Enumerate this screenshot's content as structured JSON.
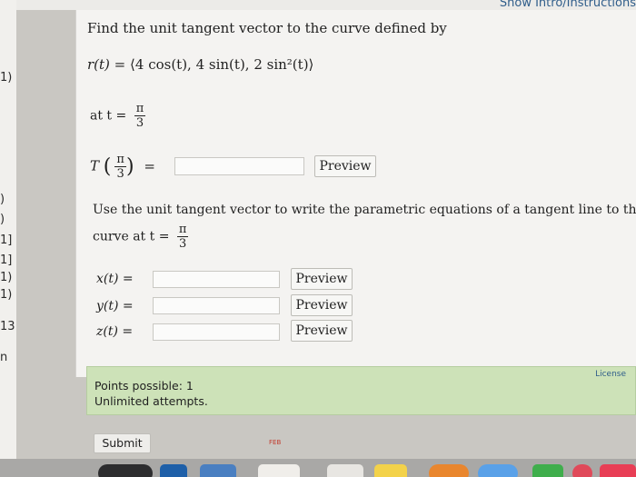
{
  "header": {
    "show_intro_link": "Show Intro/Instructions"
  },
  "left_column_fragments": [
    "1)",
    ")",
    ")",
    "1]",
    "1]",
    "1)",
    "1)",
    "13",
    "n"
  ],
  "question": {
    "title": "Find the unit tangent vector to the curve defined by",
    "r_label": "r(t) =",
    "r_expr": "⟨4 cos(t), 4 sin(t), 2 sin²(t)⟩",
    "at_t_prefix": "at t =",
    "t_num": "π",
    "t_den": "3",
    "T_label": "T",
    "T_arg_num": "π",
    "T_arg_den": "3",
    "equals": "=",
    "T_answer_value": "",
    "preview_label": "Preview"
  },
  "tangent_line": {
    "instruction_line1": "Use the unit tangent vector to write the parametric equations of a tangent line to the",
    "instruction_line2_prefix": "curve at t =",
    "t_num": "π",
    "t_den": "3",
    "fields": [
      {
        "label": "x(t) =",
        "value": "",
        "preview_label": "Preview"
      },
      {
        "label": "y(t) =",
        "value": "",
        "preview_label": "Preview"
      },
      {
        "label": "z(t) =",
        "value": "",
        "preview_label": "Preview"
      }
    ]
  },
  "info": {
    "license_link": "License",
    "points_possible": "Points possible: 1",
    "attempts": "Unlimited attempts."
  },
  "actions": {
    "submit_label": "Submit"
  },
  "dock": {
    "calendar_month": "FEB"
  }
}
